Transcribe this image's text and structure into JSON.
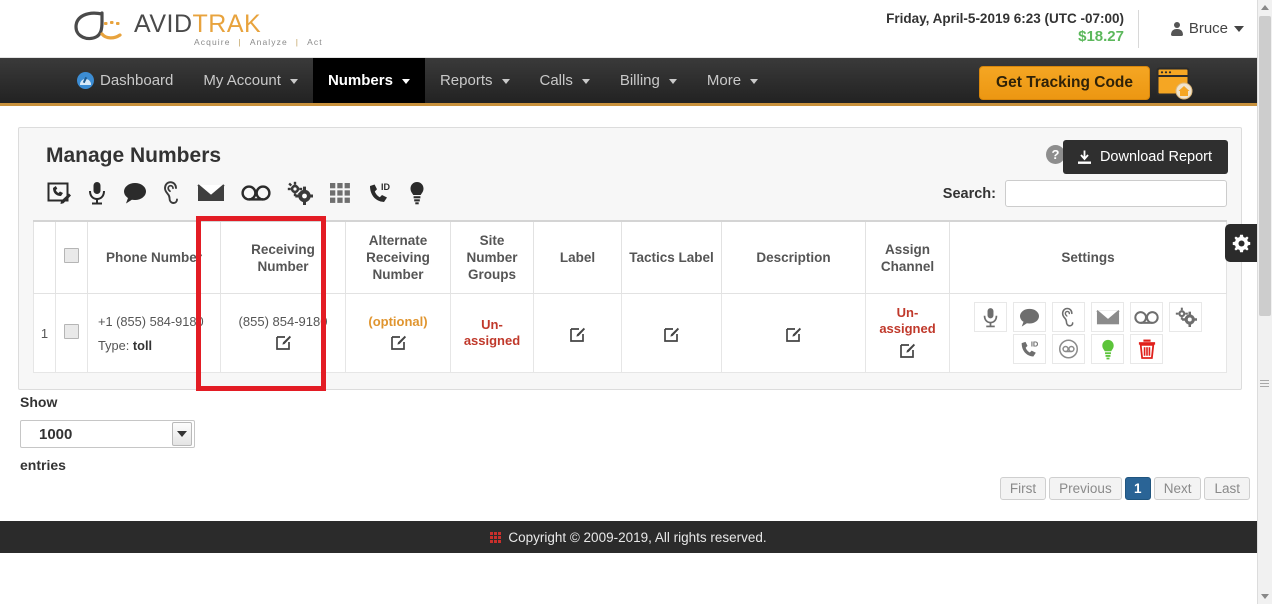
{
  "header": {
    "logo_text_primary": "AVID",
    "logo_text_secondary": "TRAK",
    "logo_tagline_1": "Acquire",
    "logo_tagline_sep": "|",
    "logo_tagline_2": "Analyze",
    "logo_tagline_3": "Act",
    "datetime": "Friday, April-5-2019 6:23 (UTC -07:00)",
    "balance": "$18.27",
    "balance_color": "#5cb85c",
    "user_name": "Bruce"
  },
  "nav": {
    "items": [
      {
        "label": "Dashboard",
        "has_caret": false,
        "active": false,
        "icon": "dashboard-icon"
      },
      {
        "label": "My Account",
        "has_caret": true,
        "active": false
      },
      {
        "label": "Numbers",
        "has_caret": true,
        "active": true
      },
      {
        "label": "Reports",
        "has_caret": true,
        "active": false
      },
      {
        "label": "Calls",
        "has_caret": true,
        "active": false
      },
      {
        "label": "Billing",
        "has_caret": true,
        "active": false
      },
      {
        "label": "More",
        "has_caret": true,
        "active": false
      }
    ],
    "tracking_button": "Get Tracking Code",
    "accent_color": "#f5a623"
  },
  "panel": {
    "title": "Manage Numbers",
    "help_label": "?",
    "download_label": "Download Report",
    "toolbar_icons": [
      "edit-phone-icon",
      "microphone-icon",
      "chat-bubble-icon",
      "ear-listen-icon",
      "envelope-icon",
      "voicemail-icon",
      "gears-icon",
      "keypad-grid-icon",
      "caller-id-icon",
      "lightbulb-icon"
    ],
    "search_label": "Search:",
    "search_value": "",
    "search_placeholder": ""
  },
  "table": {
    "columns": [
      "Phone Number",
      "Receiving Number",
      "Alternate Receiving Number",
      "Site Number Groups",
      "Label",
      "Tactics Label",
      "Description",
      "Assign Channel",
      "Settings"
    ],
    "rows": [
      {
        "index": "1",
        "phone_number": "+1 (855) 584-9180",
        "type_label": "Type:",
        "type_value": "toll",
        "receiving_number": "(855) 854-9180",
        "alternate_receiving_number": "(optional)",
        "site_number_groups": "Un-assigned",
        "label": "",
        "tactics_label": "",
        "description": "",
        "assign_channel": "Un-assigned",
        "settings_icons_row1": [
          "microphone-icon",
          "chat-bubble-icon",
          "ear-listen-icon",
          "envelope-icon",
          "voicemail-icon",
          "gears-icon"
        ],
        "settings_icons_row2": [
          "caller-id-icon",
          "headset-icon",
          "lightbulb-icon",
          "trash-icon"
        ]
      }
    ],
    "highlight_column": "Receiving Number",
    "highlight_color": "#e31c24"
  },
  "paging": {
    "show_label": "Show",
    "entries_value": "1000",
    "entries_label": "entries",
    "buttons": [
      "First",
      "Previous",
      "1",
      "Next",
      "Last"
    ],
    "active_page": "1",
    "active_color": "#2a6496"
  },
  "footer": {
    "text": "Copyright © 2009-2019, All rights reserved."
  },
  "side_tab": {
    "icon": "gear-icon"
  }
}
